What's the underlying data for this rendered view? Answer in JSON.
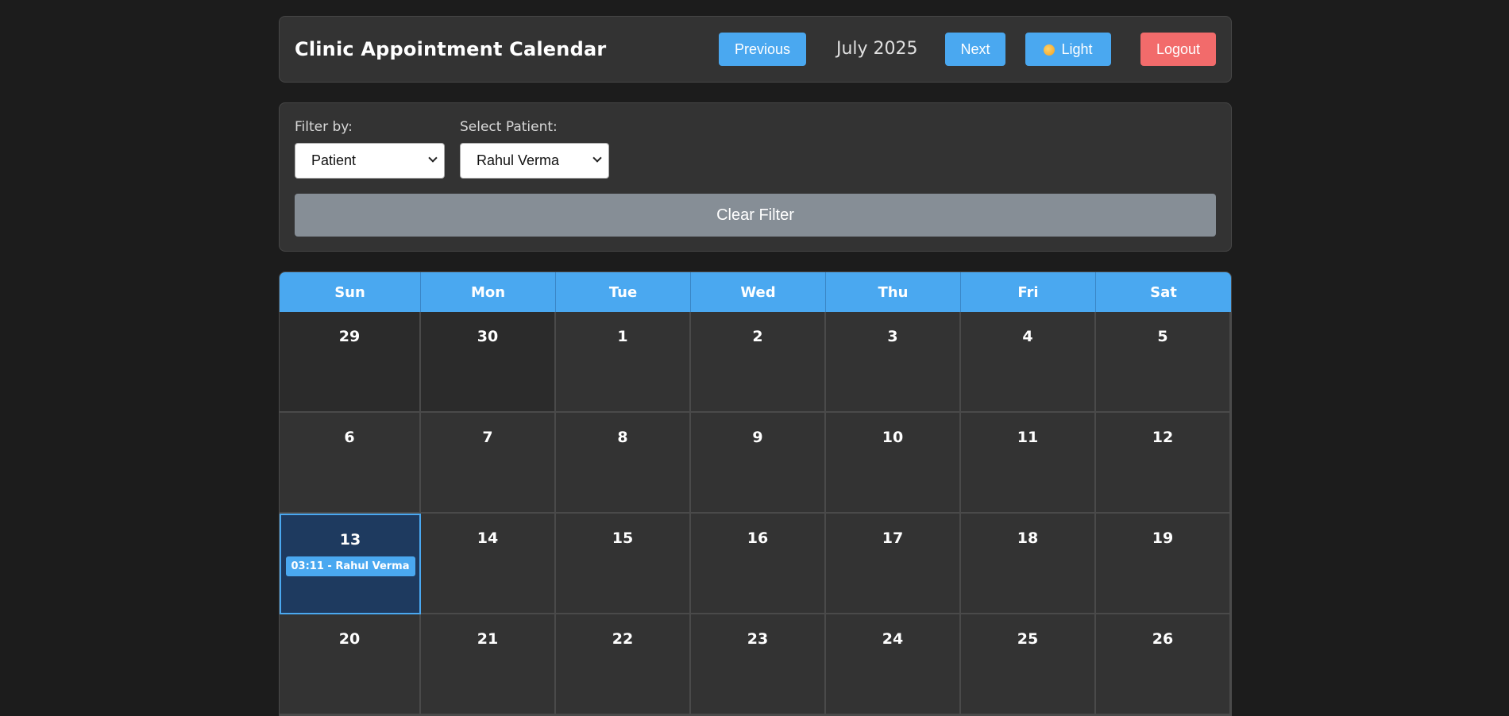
{
  "header": {
    "title": "Clinic Appointment Calendar",
    "prev_label": "Previous",
    "month_label": "July 2025",
    "next_label": "Next",
    "theme_label": "Light",
    "logout_label": "Logout"
  },
  "filter": {
    "filter_by_label": "Filter by:",
    "filter_by_value": "Patient",
    "patient_label": "Select Patient:",
    "patient_value": "Rahul Verma",
    "clear_label": "Clear Filter"
  },
  "calendar": {
    "weekdays": [
      "Sun",
      "Mon",
      "Tue",
      "Wed",
      "Thu",
      "Fri",
      "Sat"
    ],
    "weeks": [
      [
        {
          "day": "29",
          "other": true
        },
        {
          "day": "30",
          "other": true
        },
        {
          "day": "1"
        },
        {
          "day": "2"
        },
        {
          "day": "3"
        },
        {
          "day": "4"
        },
        {
          "day": "5"
        }
      ],
      [
        {
          "day": "6"
        },
        {
          "day": "7"
        },
        {
          "day": "8"
        },
        {
          "day": "9"
        },
        {
          "day": "10"
        },
        {
          "day": "11"
        },
        {
          "day": "12"
        }
      ],
      [
        {
          "day": "13",
          "today": true,
          "appointments": [
            "03:11 - Rahul Verma"
          ]
        },
        {
          "day": "14"
        },
        {
          "day": "15"
        },
        {
          "day": "16"
        },
        {
          "day": "17"
        },
        {
          "day": "18"
        },
        {
          "day": "19"
        }
      ],
      [
        {
          "day": "20"
        },
        {
          "day": "21"
        },
        {
          "day": "22"
        },
        {
          "day": "23"
        },
        {
          "day": "24"
        },
        {
          "day": "25"
        },
        {
          "day": "26"
        }
      ]
    ]
  },
  "colors": {
    "accent": "#4aa8f0",
    "danger": "#f26b6b",
    "background": "#1c1c1c",
    "panel": "#333333",
    "today_bg": "#1e3a5f"
  }
}
